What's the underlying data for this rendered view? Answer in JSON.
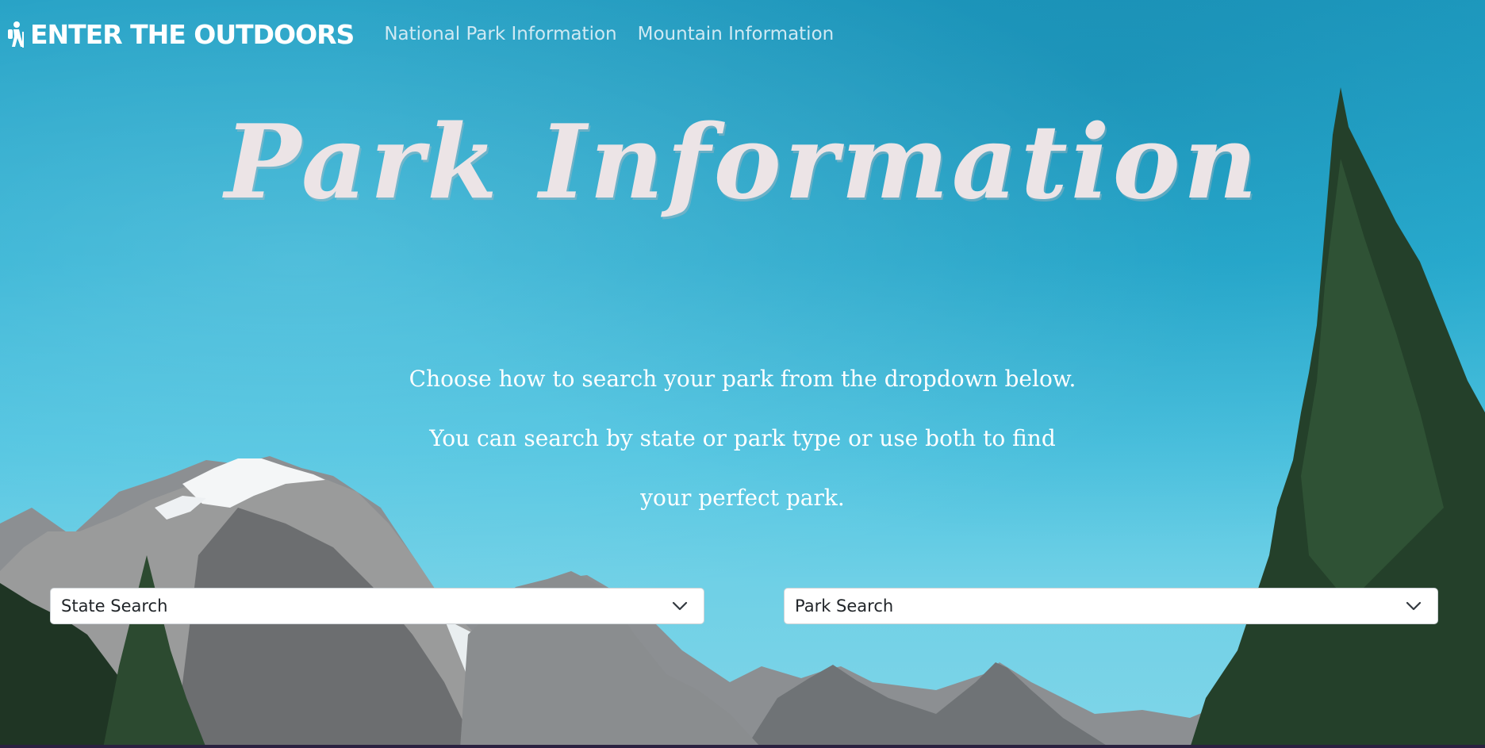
{
  "nav": {
    "brand": "ENTER THE OUTDOORS",
    "brand_icon": "hiker-icon",
    "links": [
      "National Park Information",
      "Mountain Information"
    ]
  },
  "hero": {
    "title": "Park Information",
    "intro_lines": [
      "Choose how to search your park from the dropdown below.",
      "You can search by state or park type or use both to find",
      "your perfect park."
    ]
  },
  "search": {
    "state_select": {
      "value": "State Search",
      "icon": "chevron-down-icon"
    },
    "park_select": {
      "value": "Park Search",
      "icon": "chevron-down-icon"
    }
  },
  "colors": {
    "sky": "#2ab0d3",
    "title": "#ece4e6",
    "nav_link": "#cfe9f3",
    "brand": "#ffffff"
  }
}
